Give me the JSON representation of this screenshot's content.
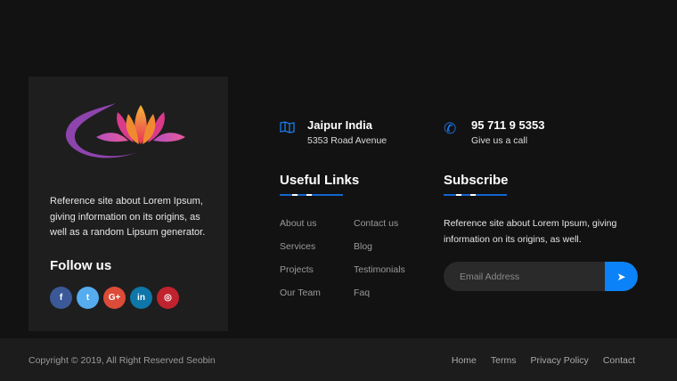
{
  "about": {
    "text": "Reference site about Lorem Ipsum, giving information on its origins, as well as a random Lipsum generator.",
    "follow_title": "Follow us",
    "socials": [
      {
        "name": "facebook",
        "glyph": "f",
        "color": "#3b5998"
      },
      {
        "name": "twitter",
        "glyph": "t",
        "color": "#55acee"
      },
      {
        "name": "google-plus",
        "glyph": "G+",
        "color": "#dd4b39"
      },
      {
        "name": "linkedin",
        "glyph": "in",
        "color": "#0e76a8"
      },
      {
        "name": "instagram",
        "glyph": "◎",
        "color": "#c0232e"
      }
    ]
  },
  "contact": {
    "address_title": "Jaipur India",
    "address_sub": "5353 Road Avenue",
    "phone_title": "95 711 9 5353",
    "phone_sub": "Give us a call"
  },
  "useful_links": {
    "title": "Useful Links",
    "col1": [
      "About us",
      "Services",
      "Projects",
      "Our Team"
    ],
    "col2": [
      "Contact us",
      "Blog",
      "Testimonials",
      "Faq"
    ]
  },
  "subscribe": {
    "title": "Subscribe",
    "text": "Reference site about Lorem Ipsum, giving information on its origins, as well.",
    "placeholder": "Email Address"
  },
  "footer": {
    "copyright": "Copyright © 2019, All Right Reserved Seobin",
    "nav": [
      "Home",
      "Terms",
      "Privacy Policy",
      "Contact"
    ]
  },
  "colors": {
    "accent": "#0b82f7",
    "background": "#121212",
    "card": "#1e1e1e"
  }
}
